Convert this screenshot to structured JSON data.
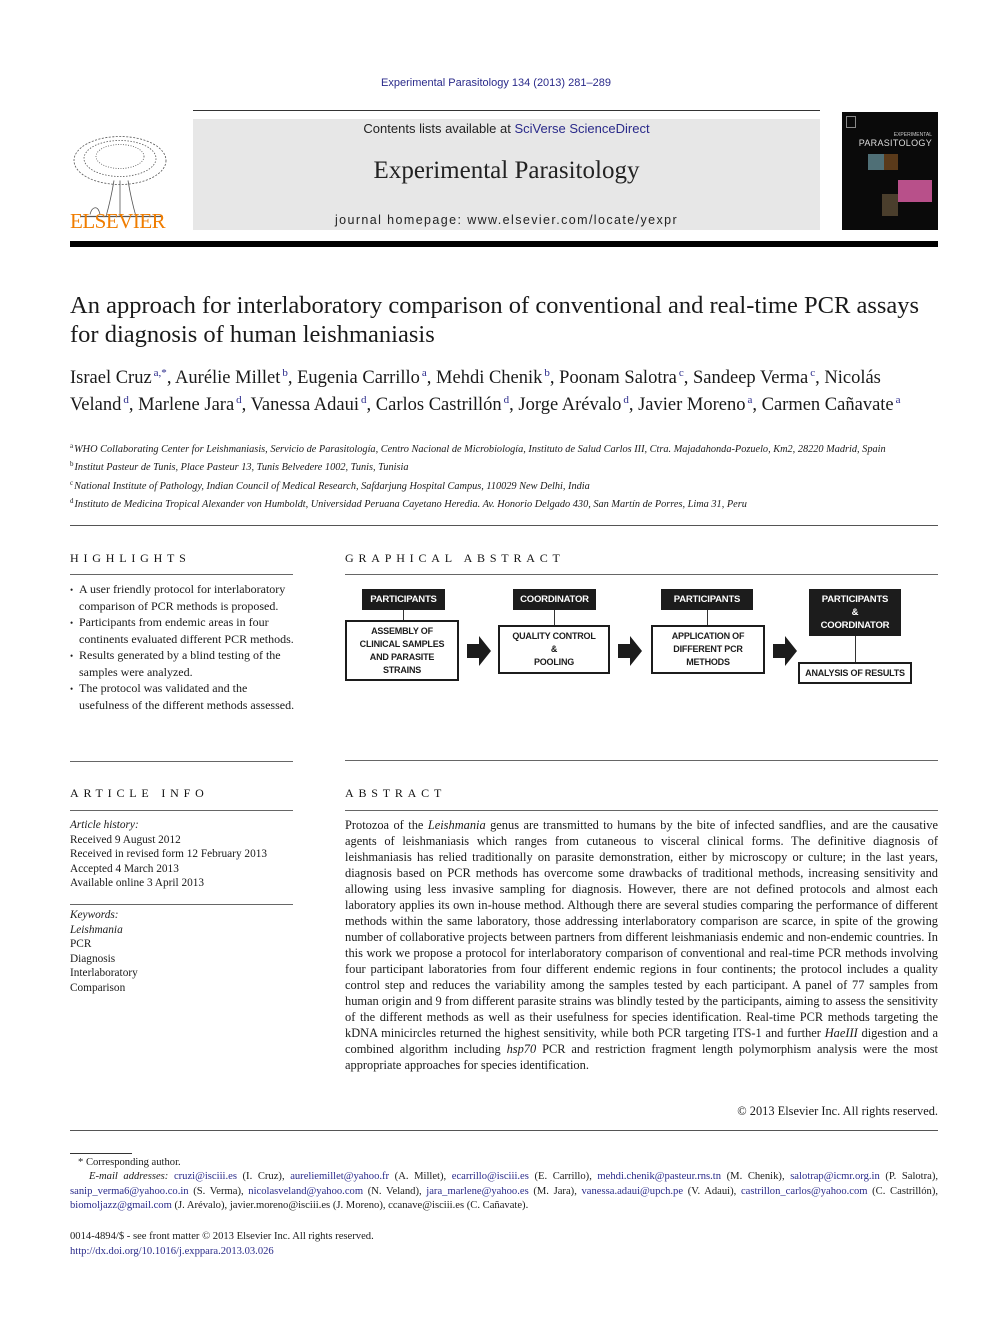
{
  "header": {
    "citation": "Experimental Parasitology 134 (2013) 281–289",
    "contents_prefix": "Contents lists available at ",
    "contents_link": "SciVerse ScienceDirect",
    "journal_title": "Experimental Parasitology",
    "homepage": "journal homepage: www.elsevier.com/locate/yexpr",
    "publisher_logo": "ELSEVIER",
    "cover_title_small": "EXPERIMENTAL",
    "cover_title_large": "PARASITOLOGY"
  },
  "article": {
    "title": "An approach for interlaboratory comparison of conventional and real-time PCR assays for diagnosis of human leishmaniasis",
    "authors": [
      {
        "name": "Israel Cruz",
        "aff": "a,*"
      },
      {
        "name": "Aurélie Millet",
        "aff": "b"
      },
      {
        "name": "Eugenia Carrillo",
        "aff": "a"
      },
      {
        "name": "Mehdi Chenik",
        "aff": "b"
      },
      {
        "name": "Poonam Salotra",
        "aff": "c"
      },
      {
        "name": "Sandeep Verma",
        "aff": "c"
      },
      {
        "name": "Nicolás Veland",
        "aff": "d"
      },
      {
        "name": "Marlene Jara",
        "aff": "d"
      },
      {
        "name": "Vanessa Adaui",
        "aff": "d"
      },
      {
        "name": "Carlos Castrillón",
        "aff": "d"
      },
      {
        "name": "Jorge Arévalo",
        "aff": "d"
      },
      {
        "name": "Javier Moreno",
        "aff": "a"
      },
      {
        "name": "Carmen Cañavate",
        "aff": "a"
      }
    ],
    "affiliations": [
      {
        "key": "a",
        "text": "WHO Collaborating Center for Leishmaniasis, Servicio de Parasitología, Centro Nacional de Microbiología, Instituto de Salud Carlos III, Ctra. Majadahonda-Pozuelo, Km2, 28220 Madrid, Spain"
      },
      {
        "key": "b",
        "text": "Institut Pasteur de Tunis, Place Pasteur 13, Tunis Belvedere 1002, Tunis, Tunisia"
      },
      {
        "key": "c",
        "text": "National Institute of Pathology, Indian Council of Medical Research, Safdarjung Hospital Campus, 110029 New Delhi, India"
      },
      {
        "key": "d",
        "text": "Instituto de Medicina Tropical Alexander von Humboldt, Universidad Peruana Cayetano Heredia. Av. Honorio Delgado 430, San Martín de Porres, Lima 31, Peru"
      }
    ]
  },
  "highlights": {
    "heading": "HIGHLIGHTS",
    "items": [
      "A user friendly protocol for interlaboratory comparison of PCR methods is proposed.",
      "Participants from endemic areas in four continents evaluated different PCR methods.",
      "Results generated by a blind testing of the samples were analyzed.",
      "The protocol was validated and the usefulness of the different methods assessed."
    ]
  },
  "graphical_abstract": {
    "heading": "GRAPHICAL ABSTRACT",
    "steps": [
      {
        "actor": "PARTICIPANTS",
        "task": "ASSEMBLY OF\nCLINICAL SAMPLES\nAND PARASITE\nSTRAINS"
      },
      {
        "actor": "COORDINATOR",
        "task": "QUALITY CONTROL\n&\nPOOLING"
      },
      {
        "actor": "PARTICIPANTS",
        "task": "APPLICATION OF\nDIFFERENT PCR\nMETHODS"
      },
      {
        "actor": "PARTICIPANTS\n&\nCOORDINATOR",
        "task": "ANALYSIS OF RESULTS"
      }
    ]
  },
  "article_info": {
    "heading": "ARTICLE INFO",
    "history_label": "Article history:",
    "history": [
      "Received 9 August 2012",
      "Received in revised form 12 February 2013",
      "Accepted 4 March 2013",
      "Available online 3 April 2013"
    ],
    "keywords_label": "Keywords:",
    "keywords": [
      "Leishmania",
      "PCR",
      "Diagnosis",
      "Interlaboratory",
      "Comparison"
    ]
  },
  "abstract": {
    "heading": "ABSTRACT",
    "segments": [
      {
        "t": "Protozoa of the "
      },
      {
        "t": "Leishmania",
        "i": true
      },
      {
        "t": " genus are transmitted to humans by the bite of infected sandflies, and are the causative agents of leishmaniasis which ranges from cutaneous to visceral clinical forms. The definitive diagnosis of leishmaniasis has relied traditionally on parasite demonstration, either by microscopy or culture; in the last years, diagnosis based on PCR methods has overcome some drawbacks of traditional methods, increasing sensitivity and allowing using less invasive sampling for diagnosis. However, there are not defined protocols and almost each laboratory applies its own in-house method. Although there are several studies comparing the performance of different methods within the same laboratory, those addressing interlaboratory comparison are scarce, in spite of the growing number of collaborative projects between partners from different leishmaniasis endemic and non-endemic countries. In this work we propose a protocol for interlaboratory comparison of conventional and real-time PCR methods involving four participant laboratories from four different endemic regions in four continents; the protocol includes a quality control step and reduces the variability among the samples tested by each participant. A panel of 77 samples from human origin and 9 from different parasite strains was blindly tested by the participants, aiming to assess the sensitivity of the different methods as well as their usefulness for species identification. Real-time PCR methods targeting the kDNA minicircles returned the highest sensitivity, while both PCR targeting ITS-1 and further "
      },
      {
        "t": "HaeIII",
        "i": true
      },
      {
        "t": " digestion and a combined algorithm including "
      },
      {
        "t": "hsp70",
        "i": true
      },
      {
        "t": " PCR and restriction fragment length polymorphism analysis were the most appropriate approaches for species identification."
      }
    ],
    "copyright": "© 2013 Elsevier Inc. All rights reserved."
  },
  "footnotes": {
    "corresponding": "* Corresponding author.",
    "email_label": "E-mail addresses:",
    "emails": [
      {
        "email": "cruzi@isciii.es",
        "who": "(I. Cruz)",
        "link": true
      },
      {
        "email": "aureliemillet@yahoo.fr",
        "who": "(A. Millet)",
        "link": true
      },
      {
        "email": "ecarrillo@isciii.es",
        "who": "(E. Carrillo)",
        "link": true
      },
      {
        "email": "mehdi.chenik@pasteur.rns.tn",
        "who": "(M. Chenik)",
        "link": true
      },
      {
        "email": "salotrap@icmr.org.in",
        "who": "(P. Salotra)",
        "link": true
      },
      {
        "email": "sanip_verma6@yahoo.co.in",
        "who": "(S. Verma)",
        "link": true
      },
      {
        "email": "nicolasveland@yahoo.com",
        "who": "(N. Veland)",
        "link": true
      },
      {
        "email": "jara_marlene@yahoo.es",
        "who": "(M. Jara)",
        "link": true
      },
      {
        "email": "vanessa.adaui@upch.pe",
        "who": "(V. Adaui)",
        "link": true
      },
      {
        "email": "castrillon_carlos@yahoo.com",
        "who": "(C. Castrillón)",
        "link": true
      },
      {
        "email": "biomoljazz@gmail.com",
        "who": "(J. Arévalo)",
        "link": true
      },
      {
        "email": "javier.moreno@isciii.es",
        "who": "(J. Moreno)",
        "link": false
      },
      {
        "email": "ccanave@isciii.es",
        "who": "(C. Cañavate).",
        "link": false
      }
    ],
    "front_matter": "0014-4894/$ - see front matter © 2013 Elsevier Inc. All rights reserved.",
    "doi": "http://dx.doi.org/10.1016/j.exppara.2013.03.026"
  }
}
